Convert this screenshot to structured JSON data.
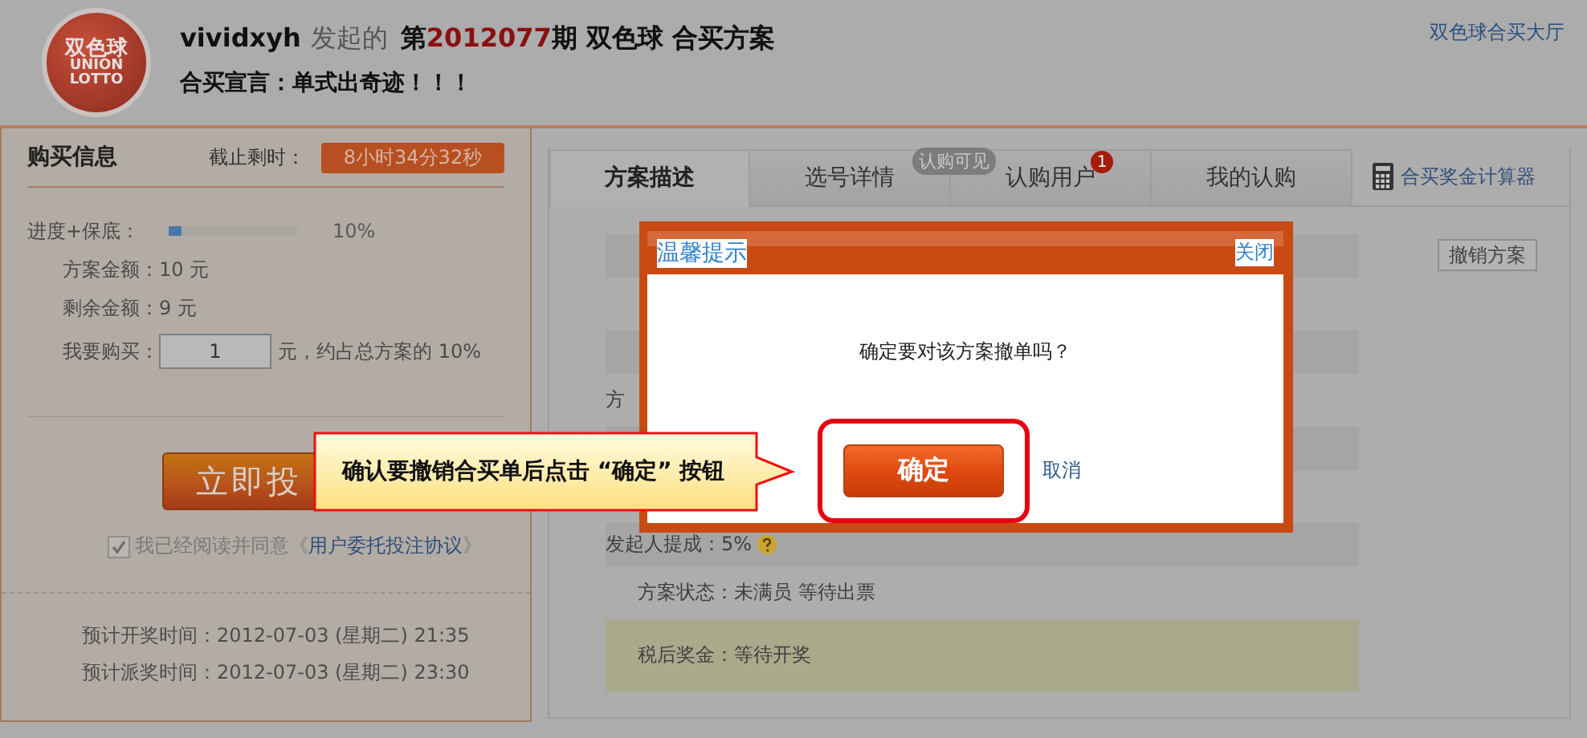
{
  "header": {
    "logo_lines": [
      "双色球",
      "UNION",
      "LOTTO"
    ],
    "user": "vividxyh",
    "action": "发起的",
    "issue_prefix": "第",
    "issue": "2012077",
    "issue_suffix": "期",
    "game": "双色球",
    "plan": "合买方案",
    "declaration": "合买宣言：单式出奇迹！！！",
    "hall_link": "双色球合买大厅"
  },
  "purchase": {
    "title": "购买信息",
    "deadline_label": "截止剩时：",
    "deadline": "8小时34分32秒",
    "progress": {
      "label": "进度+保底：",
      "level": 0.1,
      "reading": "10%"
    },
    "amounts": [
      {
        "label": "方案金额：",
        "value": "10 元"
      },
      {
        "label": "剩余金额：",
        "value": "9 元"
      }
    ],
    "buy": {
      "label": "我要购买：",
      "value": "1",
      "suffix": "元，约占总方案的 10%"
    },
    "submit": "立即投",
    "agreement": {
      "checked": true,
      "text": "我已经阅读并同意《",
      "link": "用户委托投注协议",
      "close": "》"
    },
    "times": [
      {
        "label": "预计开奖时间：",
        "value": "2012-07-03 (星期二) 21:35"
      },
      {
        "label": "预计派奖时间：",
        "value": "2012-07-03 (星期二) 23:30"
      }
    ]
  },
  "tabs": [
    {
      "label": "方案描述",
      "selected": true
    },
    {
      "label": "选号详情",
      "selected": false,
      "badge": {
        "kind": "pill",
        "text": "认购可见"
      }
    },
    {
      "label": "认购用户",
      "selected": false,
      "badge": {
        "kind": "count",
        "text": "1"
      }
    },
    {
      "label": "我的认购",
      "selected": false
    }
  ],
  "calculator_link": "合买奖金计算器",
  "cancel_plan_button": "撤销方案",
  "detail_rows": [
    {
      "kind": "band"
    },
    {
      "kind": "band"
    },
    {
      "kind": "plain",
      "text": "方"
    },
    {
      "kind": "band"
    },
    {
      "kind": "band",
      "text": "发起人提成：5%",
      "help": true
    },
    {
      "kind": "indented",
      "text": "方案状态：未满员 等待出票"
    },
    {
      "kind": "olive",
      "text": "税后奖金：等待开奖"
    }
  ],
  "dialog": {
    "title": "温馨提示",
    "close": "关闭",
    "message": "确定要对该方案撤单吗？",
    "confirm": "确定",
    "cancel": "取消"
  },
  "callout": "确认要撤销合买单后点击 “确定” 按钮"
}
